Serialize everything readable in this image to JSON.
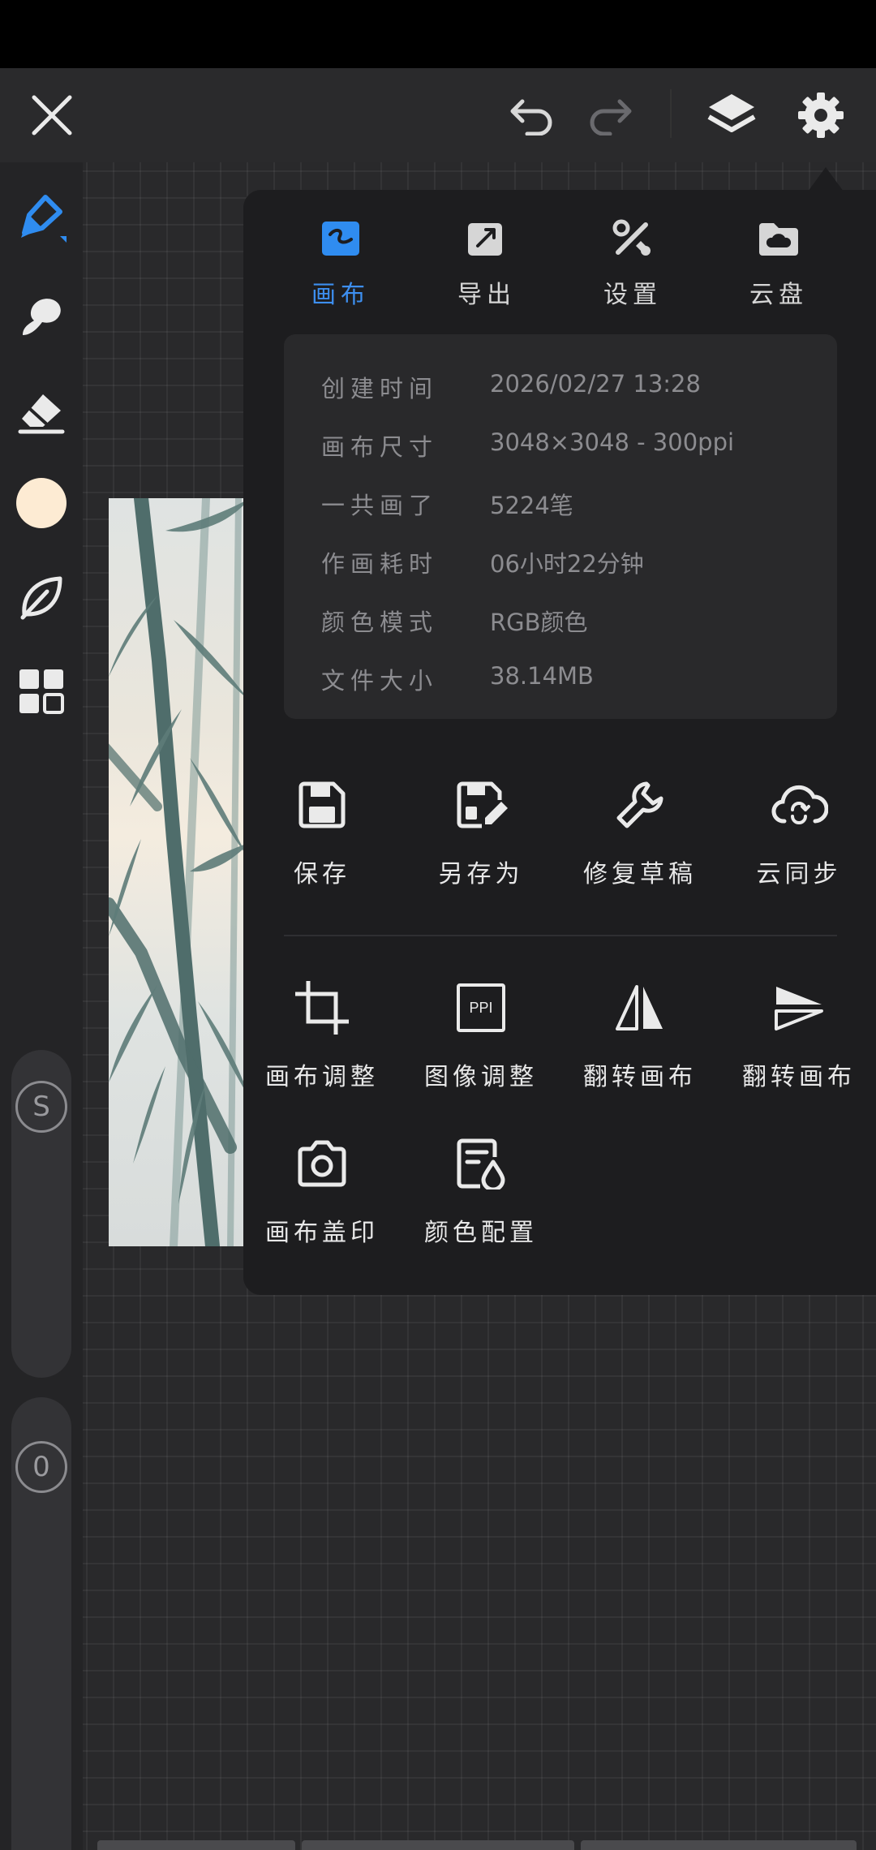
{
  "colors": {
    "accent": "#2f8cf0",
    "panel": "#1d1d1f",
    "card": "#29292b",
    "swatch": "#fdebd3"
  },
  "topbar": {
    "close_icon": "close-icon",
    "undo_icon": "undo-icon",
    "redo_icon": "redo-icon",
    "layers_icon": "layers-icon",
    "settings_icon": "gear-icon"
  },
  "left_toolbar": {
    "tools": [
      "brush-tool",
      "smudge-tool",
      "eraser-tool",
      "color-swatch",
      "leaf-tool",
      "grid-tool"
    ],
    "size_knob": "S",
    "opacity_knob": "0"
  },
  "menu": {
    "tabs": [
      {
        "label": "画布",
        "icon": "canvas-icon",
        "active": true
      },
      {
        "label": "导出",
        "icon": "export-icon",
        "active": false
      },
      {
        "label": "设置",
        "icon": "settings-tools-icon",
        "active": false
      },
      {
        "label": "云盘",
        "icon": "cloud-drive-icon",
        "active": false
      }
    ],
    "info": [
      {
        "key": "创建时间",
        "value": "2026/02/27 13:28"
      },
      {
        "key": "画布尺寸",
        "value": "3048×3048 - 300ppi"
      },
      {
        "key": "一共画了",
        "value": "5224笔"
      },
      {
        "key": "作画耗时",
        "value": "06小时22分钟"
      },
      {
        "key": "颜色模式",
        "value": "RGB颜色"
      },
      {
        "key": "文件大小",
        "value": "38.14MB"
      }
    ],
    "actions_row1": [
      {
        "label": "保存",
        "icon": "save-icon"
      },
      {
        "label": "另存为",
        "icon": "save-as-icon"
      },
      {
        "label": "修复草稿",
        "icon": "wrench-icon"
      },
      {
        "label": "云同步",
        "icon": "cloud-sync-icon"
      }
    ],
    "actions_row2": [
      {
        "label": "画布调整",
        "icon": "crop-icon"
      },
      {
        "label": "图像调整",
        "icon": "ppi-icon",
        "icon_text": "PPI"
      },
      {
        "label": "翻转画布",
        "icon": "flip-horizontal-icon"
      },
      {
        "label": "翻转画布",
        "icon": "flip-vertical-icon"
      }
    ],
    "actions_row3": [
      {
        "label": "画布盖印",
        "icon": "camera-icon"
      },
      {
        "label": "颜色配置",
        "icon": "color-profile-icon"
      }
    ]
  }
}
